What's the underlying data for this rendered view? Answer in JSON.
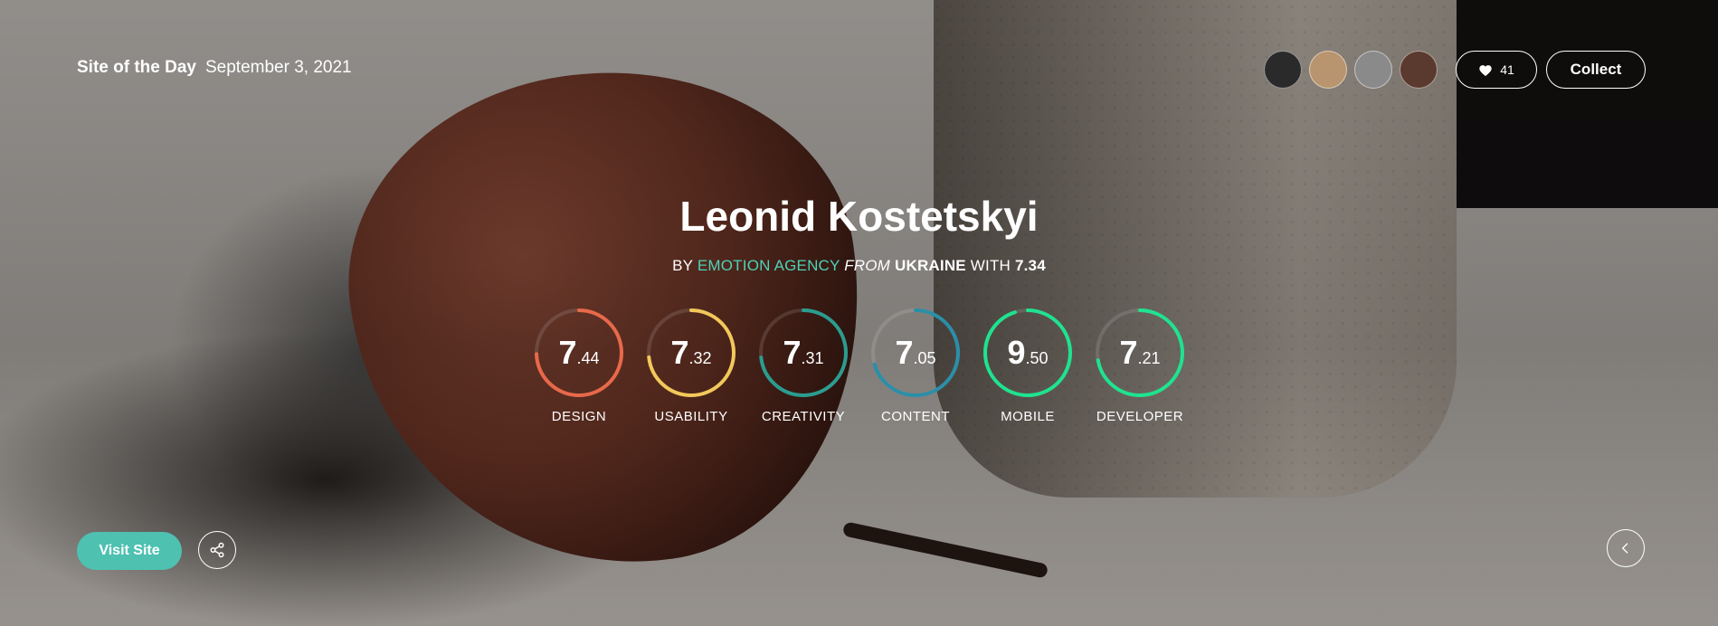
{
  "header": {
    "label": "Site of the Day",
    "date": "September 3, 2021"
  },
  "jury": {
    "avatars": [
      {
        "color": "#2a2a2a"
      },
      {
        "color": "#b8956f"
      },
      {
        "color": "#8a8a8a"
      },
      {
        "color": "#5a3a2e"
      }
    ]
  },
  "actions": {
    "likes": "41",
    "collect_label": "Collect",
    "visit_label": "Visit Site"
  },
  "site": {
    "title": "Leonid Kostetskyi",
    "by": "BY",
    "agency": "EMOTION AGENCY",
    "from": "FROM",
    "country": "UKRAINE",
    "with": "WITH",
    "score": "7.34"
  },
  "scores": [
    {
      "int": "7",
      "dec": ".44",
      "value": 7.44,
      "label": "DESIGN",
      "color": "#e8694a"
    },
    {
      "int": "7",
      "dec": ".32",
      "value": 7.32,
      "label": "USABILITY",
      "color": "#f2c85b"
    },
    {
      "int": "7",
      "dec": ".31",
      "value": 7.31,
      "label": "CREATIVITY",
      "color": "#2a9d8f"
    },
    {
      "int": "7",
      "dec": ".05",
      "value": 7.05,
      "label": "CONTENT",
      "color": "#2a8fa8"
    },
    {
      "int": "9",
      "dec": ".50",
      "value": 9.5,
      "label": "MOBILE",
      "color": "#1ee38f"
    },
    {
      "int": "7",
      "dec": ".21",
      "value": 7.21,
      "label": "DEVELOPER",
      "color": "#1ee38f"
    }
  ],
  "icons": {
    "like": "heart-icon",
    "share": "share-icon",
    "prev": "chevron-left-icon"
  }
}
